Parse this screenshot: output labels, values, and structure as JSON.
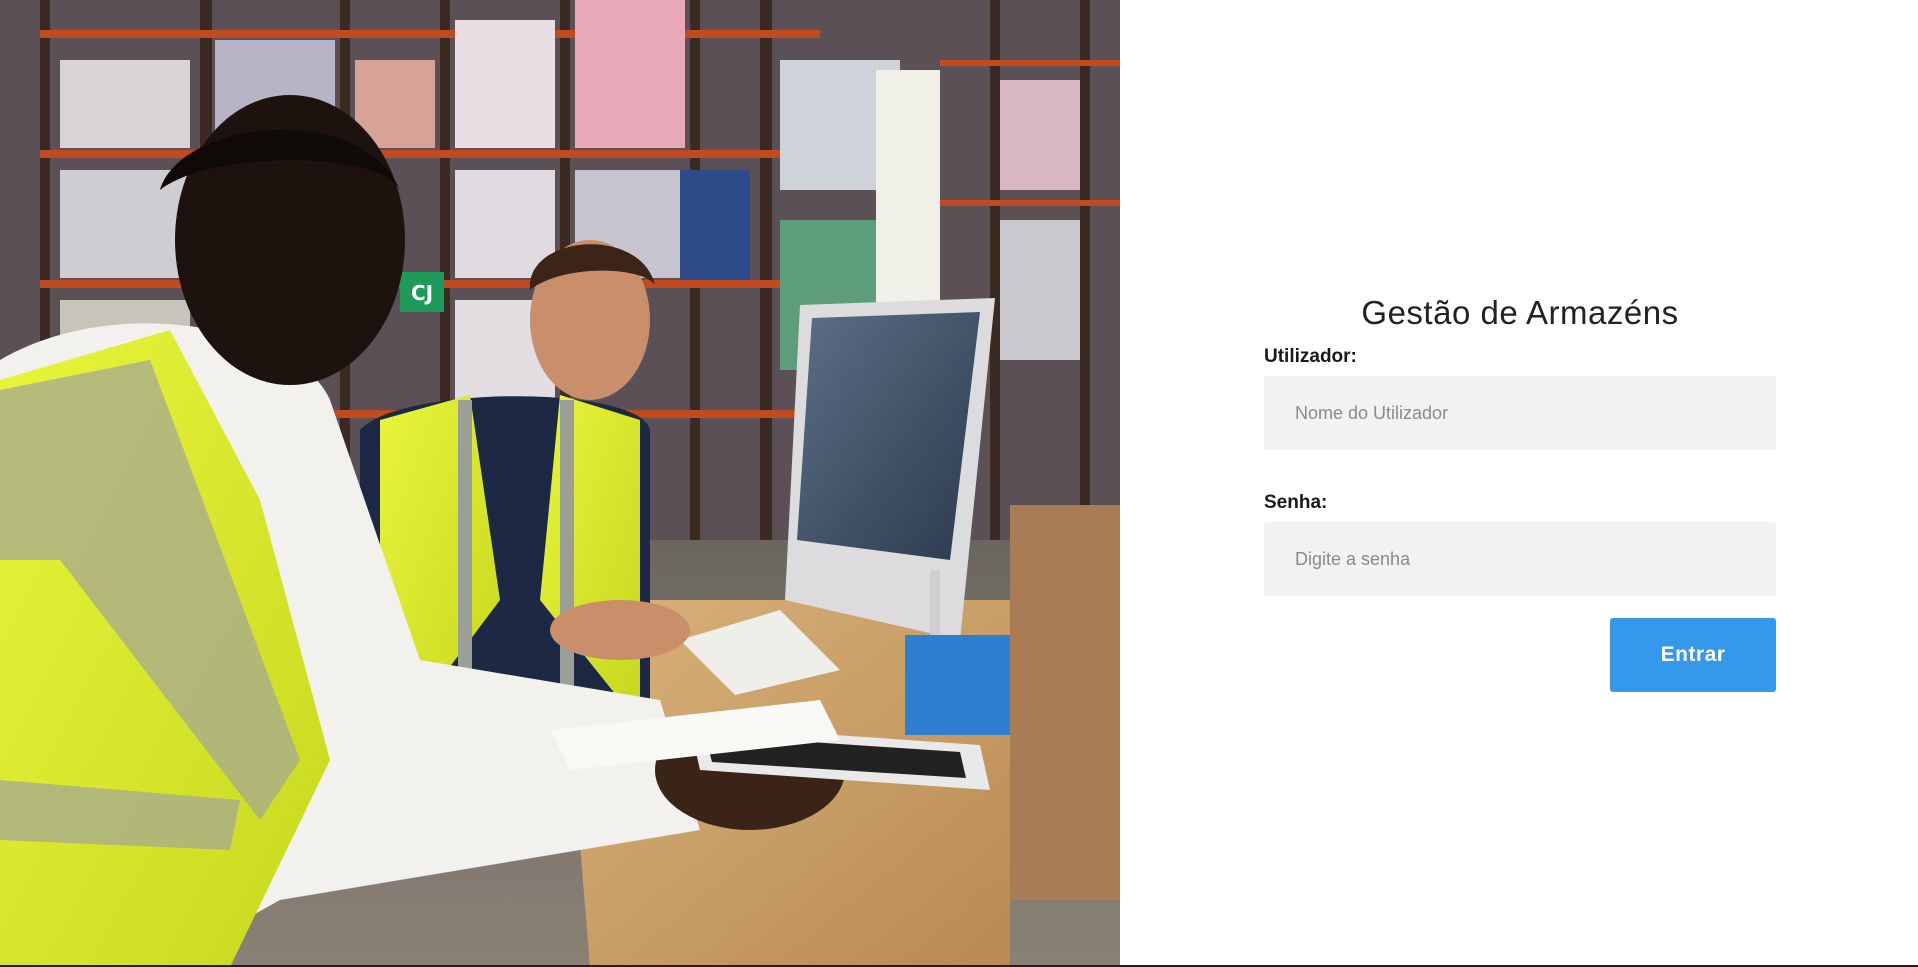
{
  "login": {
    "title": "Gestão de Armazéns",
    "username_label": "Utilizador:",
    "username_placeholder": "Nome do Utilizador",
    "username_value": "",
    "password_label": "Senha:",
    "password_placeholder": "Digite a senha",
    "password_value": "",
    "submit_label": "Entrar"
  },
  "photo": {
    "description_icon": "warehouse-photo",
    "sign_text": "CJ"
  },
  "colors": {
    "accent": "#3498eb",
    "input_bg": "#f2f2f2",
    "title": "#222222"
  }
}
